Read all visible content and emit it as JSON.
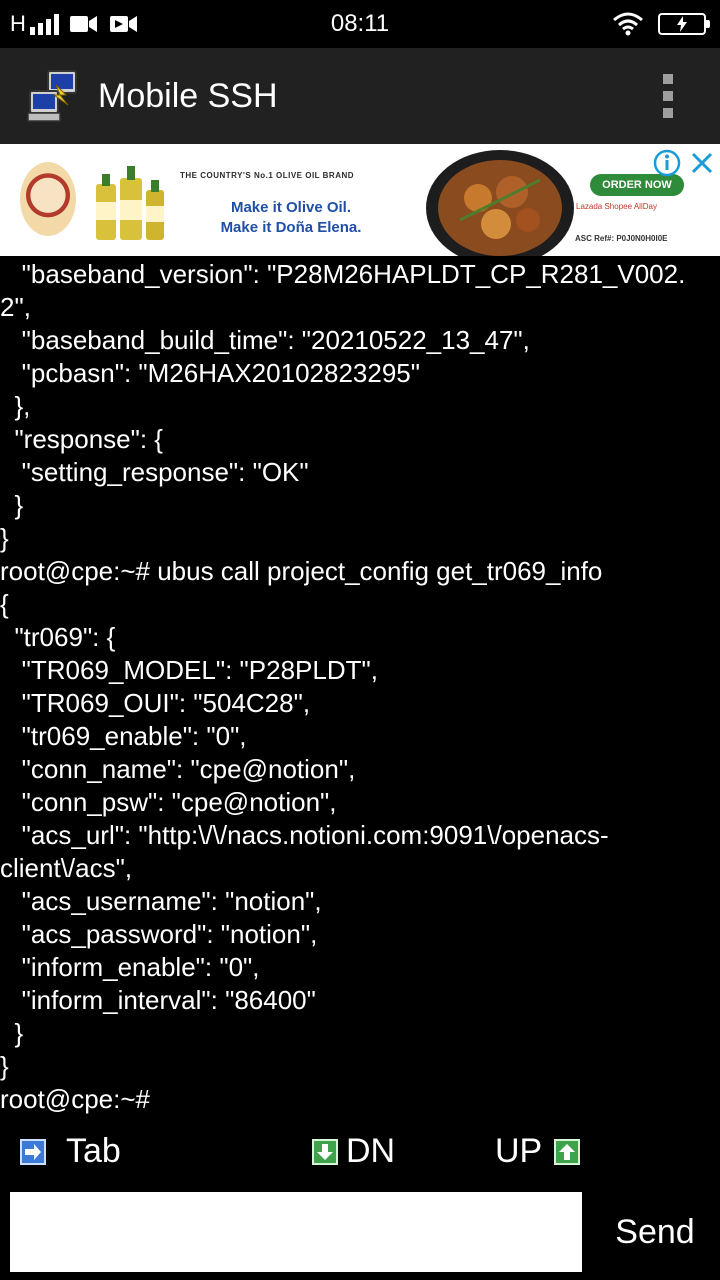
{
  "status_bar": {
    "carrier": "H",
    "time": "08:11"
  },
  "app_bar": {
    "title": "Mobile SSH",
    "icon": "putty-computer-icon"
  },
  "ad": {
    "topline": "THE COUNTRY'S No.1 OLIVE OIL BRAND",
    "slogan_line1": "Make it Olive Oil.",
    "slogan_line2": "Make it Doña Elena.",
    "cta": "ORDER NOW",
    "shops": "Lazada  Shopee  AllDay",
    "ref": "ASC Ref#: P0J0N0H0I0E",
    "info_icon": "info-icon",
    "close_icon": "close-icon"
  },
  "terminal": {
    "lines": [
      "   \"baseband_version\": \"P28M26HAPLDT_CP_R281_V002.",
      "2\",",
      "   \"baseband_build_time\": \"20210522_13_47\",",
      "   \"pcbasn\": \"M26HAX20102823295\"",
      "  },",
      "  \"response\": {",
      "   \"setting_response\": \"OK\"",
      "  }",
      "}",
      "root@cpe:~# ubus call project_config get_tr069_info",
      "{",
      "  \"tr069\": {",
      "   \"TR069_MODEL\": \"P28PLDT\",",
      "   \"TR069_OUI\": \"504C28\",",
      "   \"tr069_enable\": \"0\",",
      "   \"conn_name\": \"cpe@notion\",",
      "   \"conn_psw\": \"cpe@notion\",",
      "   \"acs_url\": \"http:\\/\\/nacs.notioni.com:9091\\/openacs-",
      "client\\/acs\",",
      "   \"acs_username\": \"notion\",",
      "   \"acs_password\": \"notion\",",
      "   \"inform_enable\": \"0\",",
      "   \"inform_interval\": \"86400\"",
      "  }",
      "}",
      "root@cpe:~#"
    ]
  },
  "keys": {
    "tab_label": "Tab",
    "dn_label": "DN",
    "up_label": "UP"
  },
  "input": {
    "value": "",
    "placeholder": ""
  },
  "send_label": "Send",
  "colors": {
    "terminal_bg": "#000000",
    "terminal_fg": "#ffffff",
    "app_bar": "#212121",
    "key_arrow_green": "#3fa34d",
    "key_tab_blue": "#3b7ad6"
  }
}
